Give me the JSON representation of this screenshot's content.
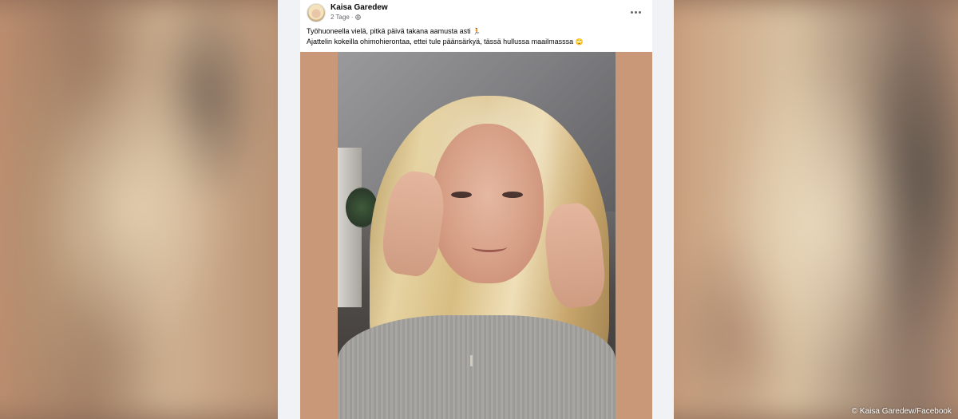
{
  "post": {
    "author": "Kaisa Garedew",
    "timestamp": "2 Tage",
    "separator": "·",
    "privacy_icon": "globe-icon",
    "more_icon": "more-options-icon",
    "text_line1": "Työhuoneella vielä, pitkä päivä takana aamusta asti",
    "text_line1_emoji": "🏃",
    "text_line2": "Ajattelin kokeilla ohimohierontaa, ettei tule päänsärkyä, tässä hullussa maailmasssa",
    "text_line2_emoji": "🙄"
  },
  "credit": "© Kaisa Garedew/Facebook",
  "colors": {
    "feed_background": "#f0f2f5",
    "card_background": "#ffffff",
    "media_background": "#c89878",
    "text_primary": "#050505",
    "text_secondary": "#65676b"
  }
}
